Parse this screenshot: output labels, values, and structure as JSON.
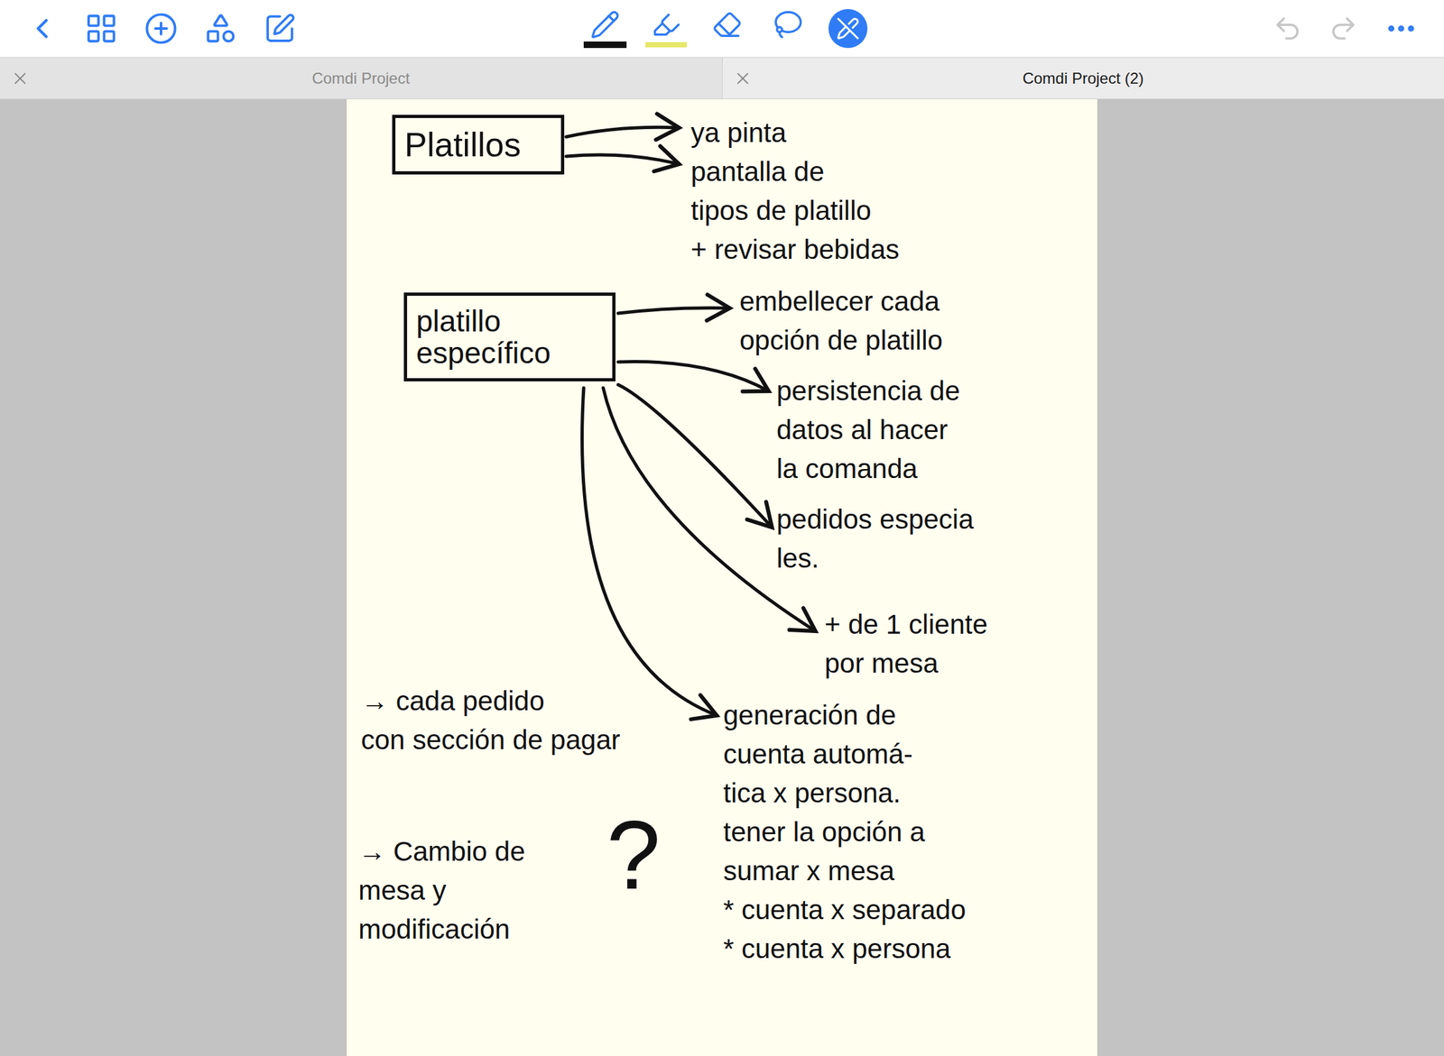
{
  "tools": [
    {
      "kind": "pen",
      "selected": true,
      "color": "#111111"
    },
    {
      "kind": "highlighter",
      "selected": false,
      "color": "#e6e86a"
    },
    {
      "kind": "eraser",
      "selected": false
    },
    {
      "kind": "lasso",
      "selected": false
    },
    {
      "kind": "draw-mode",
      "selected": true
    }
  ],
  "history": {
    "undo_disabled": true,
    "redo_disabled": true
  },
  "tabs": [
    {
      "label": "Comdi Project",
      "selected": false
    },
    {
      "label": "Comdi Project (2)",
      "selected": true
    }
  ],
  "page": {
    "boxes": [
      {
        "lines": [
          "Platillos"
        ]
      },
      {
        "lines": [
          "platillo",
          "específico"
        ]
      }
    ],
    "notes": [
      {
        "lines": [
          "ya pinta",
          "pantalla de",
          "tipos de platillo",
          "+ revisar bebidas"
        ]
      },
      {
        "lines": [
          "embellecer cada",
          "opción de platillo"
        ]
      },
      {
        "lines": [
          "persistencia de",
          "datos al hacer",
          "la comanda"
        ]
      },
      {
        "lines": [
          "pedidos especia",
          "les."
        ]
      },
      {
        "lines": [
          "+ de 1 cliente",
          "por mesa"
        ]
      },
      {
        "lines": [
          "generación de",
          "cuenta automá-",
          "tica x persona.",
          "tener la opción a",
          "sumar x mesa",
          "* cuenta x separado",
          "* cuenta x persona"
        ]
      },
      {
        "lines": [
          "→ cada pedido",
          "con sección de pagar"
        ]
      },
      {
        "lines": [
          "→ Cambio de",
          "mesa y",
          "modificación"
        ]
      }
    ],
    "question": "?"
  }
}
